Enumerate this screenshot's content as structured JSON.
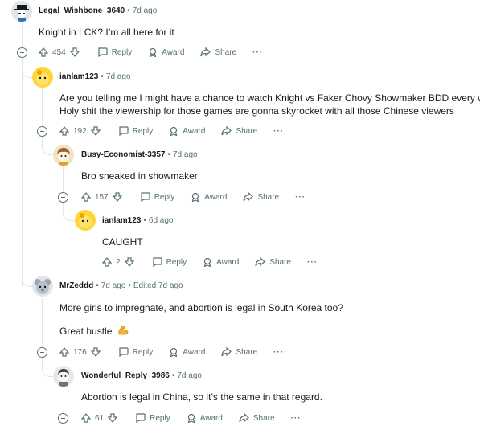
{
  "comments": [
    {
      "username": "Legal_Wishbone_3640",
      "age": "7d ago",
      "body": [
        "Knight in LCK? I’m all here for it"
      ],
      "score": "454",
      "reply": "Reply",
      "award": "Award",
      "share": "Share",
      "more": "···"
    },
    {
      "username": "ianlam123",
      "age": "7d ago",
      "body": [
        "Are you telling me I might have a chance to watch Knight vs Faker Chovy Showmaker BDD every week",
        "Holy shit the viewership for those games are gonna skyrocket with all those Chinese viewers"
      ],
      "score": "192",
      "reply": "Reply",
      "award": "Award",
      "share": "Share",
      "more": "···"
    },
    {
      "username": "Busy-Economist-3357",
      "age": "7d ago",
      "body": [
        "Bro sneaked in showmaker"
      ],
      "score": "157",
      "reply": "Reply",
      "award": "Award",
      "share": "Share",
      "more": "···"
    },
    {
      "username": "ianlam123",
      "age": "6d ago",
      "body": [
        "CAUGHT"
      ],
      "score": "2",
      "reply": "Reply",
      "award": "Award",
      "share": "Share",
      "more": "···"
    },
    {
      "username": "MrZeddd",
      "age": "7d ago",
      "edited": "Edited 7d ago",
      "body": [
        "More girls to impregnate, and abortion is legal in South Korea too?",
        "Great hustle"
      ],
      "emoji": "flexed-biceps-emoji",
      "score": "176",
      "reply": "Reply",
      "award": "Award",
      "share": "Share",
      "more": "···"
    },
    {
      "username": "Wonderful_Reply_3986",
      "age": "7d ago",
      "body": [
        "Abortion is legal in China, so it’s the same in that regard."
      ],
      "score": "61",
      "reply": "Reply",
      "award": "Award",
      "share": "Share",
      "more": "···"
    }
  ],
  "colors": {
    "text": "#1a1a1b",
    "meta": "#576f76",
    "thread_line": "#e2e4e6",
    "avatar_yellow": "#ffd635"
  }
}
